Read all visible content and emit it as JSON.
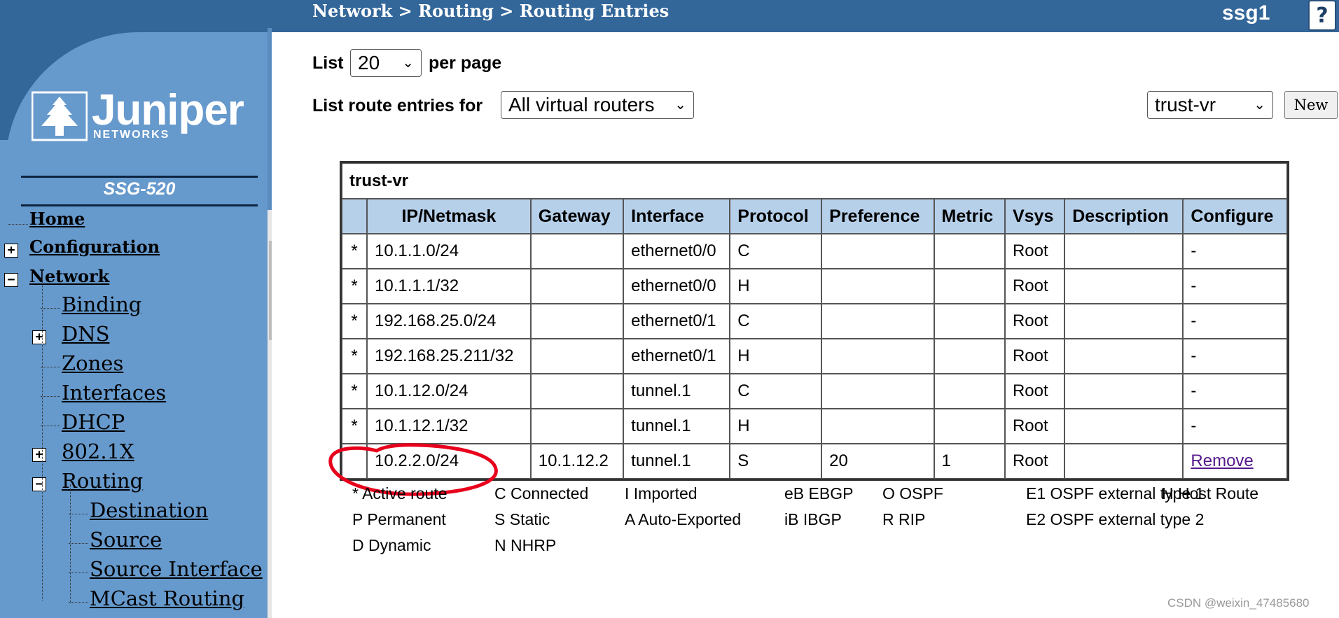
{
  "header": {
    "breadcrumb": "Network > Routing > Routing Entries",
    "hostname": "ssg1",
    "help_label": "?"
  },
  "sidebar": {
    "logo_text": "Juniper",
    "logo_subtext": "NETWORKS",
    "model": "SSG-520",
    "items": [
      {
        "label": "Home",
        "toggle": ""
      },
      {
        "label": "Configuration",
        "toggle": "+"
      },
      {
        "label": "Network",
        "toggle": "−"
      },
      {
        "label": "Binding",
        "toggle": ""
      },
      {
        "label": "DNS",
        "toggle": "+"
      },
      {
        "label": "Zones",
        "toggle": ""
      },
      {
        "label": "Interfaces",
        "toggle": ""
      },
      {
        "label": "DHCP",
        "toggle": ""
      },
      {
        "label": "802.1X",
        "toggle": "+"
      },
      {
        "label": "Routing",
        "toggle": "−"
      },
      {
        "label": "Destination",
        "toggle": ""
      },
      {
        "label": "Source",
        "toggle": ""
      },
      {
        "label": "Source Interface",
        "toggle": ""
      },
      {
        "label": "MCast Routing",
        "toggle": ""
      }
    ]
  },
  "controls": {
    "list_label": "List",
    "per_page_value": "20",
    "per_page_label": "per page",
    "route_entries_label": "List route entries for",
    "router_filter_value": "All virtual routers",
    "new_vr_value": "trust-vr",
    "new_button": "New"
  },
  "table": {
    "caption": "trust-vr",
    "columns": [
      "IP/Netmask",
      "Gateway",
      "Interface",
      "Protocol",
      "Preference",
      "Metric",
      "Vsys",
      "Description",
      "Configure"
    ],
    "rows": [
      {
        "active": "*",
        "ip": "10.1.1.0/24",
        "gateway": "",
        "interface": "ethernet0/0",
        "protocol": "C",
        "preference": "",
        "metric": "",
        "vsys": "Root",
        "description": "",
        "configure": "-"
      },
      {
        "active": "*",
        "ip": "10.1.1.1/32",
        "gateway": "",
        "interface": "ethernet0/0",
        "protocol": "H",
        "preference": "",
        "metric": "",
        "vsys": "Root",
        "description": "",
        "configure": "-"
      },
      {
        "active": "*",
        "ip": "192.168.25.0/24",
        "gateway": "",
        "interface": "ethernet0/1",
        "protocol": "C",
        "preference": "",
        "metric": "",
        "vsys": "Root",
        "description": "",
        "configure": "-"
      },
      {
        "active": "*",
        "ip": "192.168.25.211/32",
        "gateway": "",
        "interface": "ethernet0/1",
        "protocol": "H",
        "preference": "",
        "metric": "",
        "vsys": "Root",
        "description": "",
        "configure": "-"
      },
      {
        "active": "*",
        "ip": "10.1.12.0/24",
        "gateway": "",
        "interface": "tunnel.1",
        "protocol": "C",
        "preference": "",
        "metric": "",
        "vsys": "Root",
        "description": "",
        "configure": "-"
      },
      {
        "active": "*",
        "ip": "10.1.12.1/32",
        "gateway": "",
        "interface": "tunnel.1",
        "protocol": "H",
        "preference": "",
        "metric": "",
        "vsys": "Root",
        "description": "",
        "configure": "-"
      },
      {
        "active": "",
        "ip": "10.2.2.0/24",
        "gateway": "10.1.12.2",
        "interface": "tunnel.1",
        "protocol": "S",
        "preference": "20",
        "metric": "1",
        "vsys": "Root",
        "description": "",
        "configure": "Remove"
      }
    ]
  },
  "legend": [
    {
      "code": "*",
      "text": "Active route"
    },
    {
      "code": "C",
      "text": "Connected"
    },
    {
      "code": "I",
      "text": "Imported"
    },
    {
      "code": "eB",
      "text": "EBGP"
    },
    {
      "code": "O",
      "text": "OSPF"
    },
    {
      "code": "E1",
      "text": "OSPF external type 1"
    },
    {
      "code": "H",
      "text": "Host Route"
    },
    {
      "code": "P",
      "text": "Permanent"
    },
    {
      "code": "S",
      "text": "Static"
    },
    {
      "code": "A",
      "text": "Auto-Exported"
    },
    {
      "code": "iB",
      "text": "IBGP"
    },
    {
      "code": "R",
      "text": "RIP"
    },
    {
      "code": "E2",
      "text": "OSPF external type 2"
    },
    {
      "code": "D",
      "text": "Dynamic"
    },
    {
      "code": "N",
      "text": "NHRP"
    }
  ],
  "watermark": "CSDN @weixin_47485680",
  "colors": {
    "header_blue": "#336699",
    "sidebar_blue": "#6699cc",
    "table_header": "#b7d0ea",
    "annotation_red": "#e8001c"
  }
}
